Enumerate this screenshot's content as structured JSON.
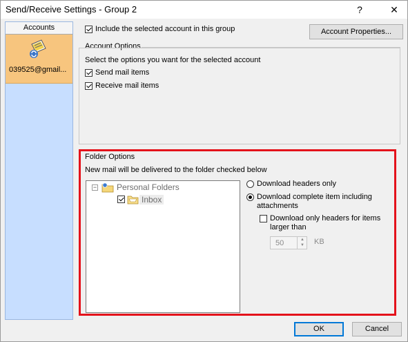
{
  "window": {
    "title": "Send/Receive Settings - Group 2",
    "help_label": "?",
    "close_label": "✕"
  },
  "sidebar": {
    "header": "Accounts",
    "items": [
      {
        "label": "039525@gmail...",
        "icon": "account-icon"
      }
    ]
  },
  "account": {
    "include_label": "Include the selected account in this group",
    "include_checked": true,
    "properties_label": "Account Properties..."
  },
  "account_options": {
    "header": "Account Options",
    "description": "Select the options you want for the selected account",
    "send_label": "Send mail items",
    "send_checked": true,
    "receive_label": "Receive mail items",
    "receive_checked": true
  },
  "folder_options": {
    "header": "Folder Options",
    "description": "New mail will be delivered to the folder checked below",
    "tree": {
      "root": "Personal Folders",
      "expander": "−",
      "children": [
        {
          "label": "Inbox",
          "checked": true
        }
      ]
    },
    "radios": [
      {
        "label": "Download headers only",
        "checked": false
      },
      {
        "label_lines": [
          "Download complete item including",
          "attachments"
        ],
        "checked": true
      }
    ],
    "limit": {
      "label_lines": [
        "Download only headers for items",
        "larger than"
      ],
      "checked": false,
      "value": "50",
      "unit": "KB"
    }
  },
  "footer": {
    "ok_label": "OK",
    "cancel_label": "Cancel"
  },
  "colors": {
    "highlight": "#e4121b",
    "sidebar_bg": "#c7deff",
    "selected_item": "#f7c57e"
  }
}
